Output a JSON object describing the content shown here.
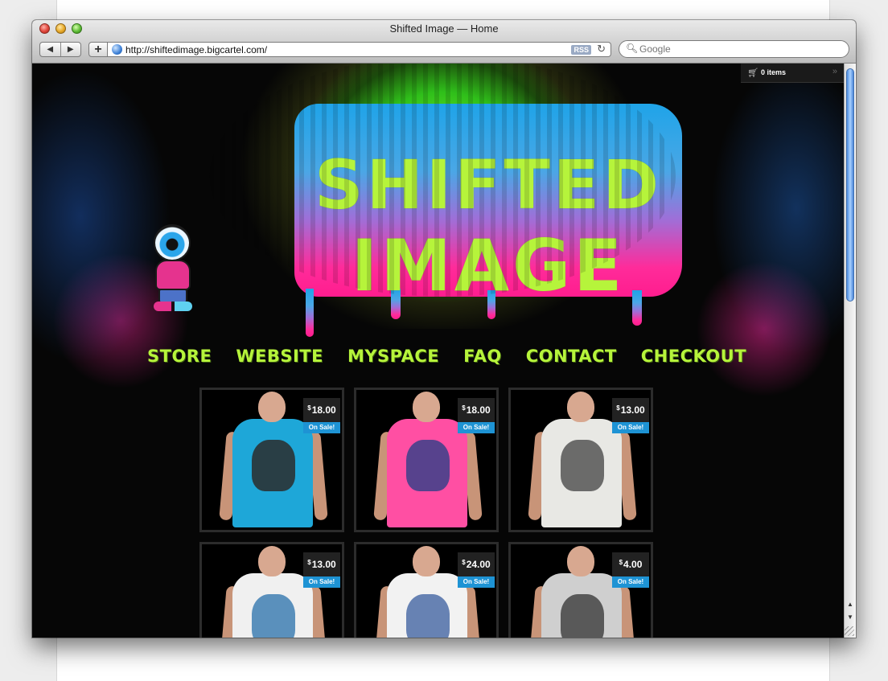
{
  "browser": {
    "window_title": "Shifted Image — Home",
    "url": "http://shiftedimage.bigcartel.com/",
    "rss_label": "RSS",
    "search_placeholder": "Google",
    "back_icon": "chevron-left-icon",
    "forward_icon": "chevron-right-icon"
  },
  "cart": {
    "label": "0 items"
  },
  "logo": {
    "line1": "SHIFTED",
    "line2": "IMAGE"
  },
  "nav": {
    "items": [
      {
        "label": "STORE"
      },
      {
        "label": "WEBSITE"
      },
      {
        "label": "MYSPACE"
      },
      {
        "label": "FAQ"
      },
      {
        "label": "CONTACT"
      },
      {
        "label": "CHECKOUT"
      }
    ]
  },
  "products": [
    {
      "currency": "$",
      "price": "18.00",
      "badge": "On Sale!",
      "shirt_color": "#1ea7d8",
      "print_color": "#2b2b2b"
    },
    {
      "currency": "$",
      "price": "18.00",
      "badge": "On Sale!",
      "shirt_color": "#ff4fa3",
      "print_color": "#3a3f8a"
    },
    {
      "currency": "$",
      "price": "13.00",
      "badge": "On Sale!",
      "shirt_color": "#e8e8e4",
      "print_color": "#555555"
    },
    {
      "currency": "$",
      "price": "13.00",
      "badge": "On Sale!",
      "shirt_color": "#f0f0f0",
      "print_color": "#3f7fb3"
    },
    {
      "currency": "$",
      "price": "24.00",
      "badge": "On Sale!",
      "shirt_color": "#f2f2f2",
      "print_color": "#4f6ea8"
    },
    {
      "currency": "$",
      "price": "4.00",
      "badge": "On Sale!",
      "shirt_color": "#cfcfcf",
      "print_color": "#444444"
    }
  ],
  "colors": {
    "accent_green": "#b6f43b",
    "sale_blue": "#1e93d4"
  }
}
